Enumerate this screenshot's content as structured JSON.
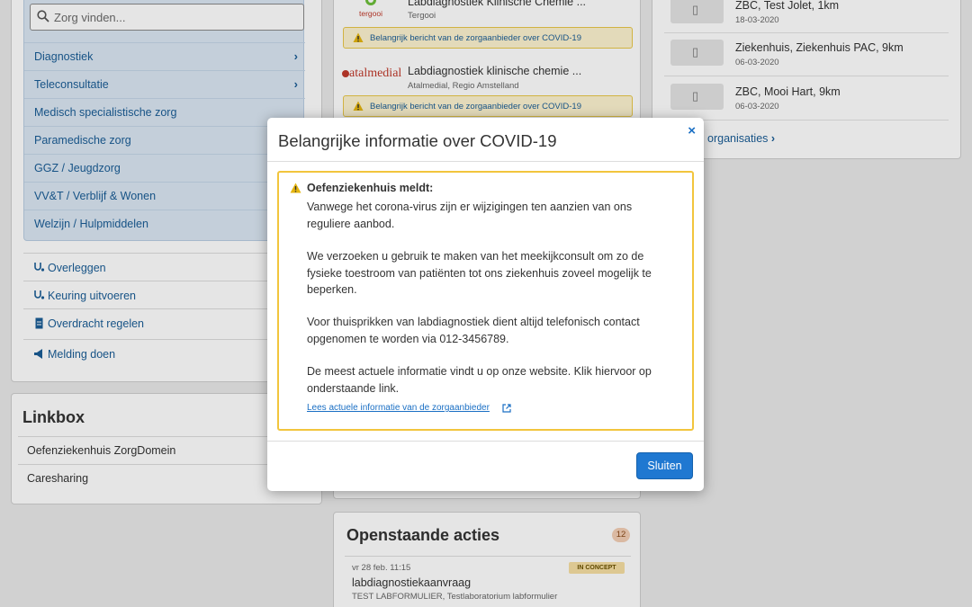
{
  "search": {
    "placeholder": "Zorg vinden..."
  },
  "categories": [
    {
      "label": "Diagnostiek"
    },
    {
      "label": "Teleconsultatie"
    },
    {
      "label": "Medisch specialistische zorg"
    },
    {
      "label": "Paramedische zorg"
    },
    {
      "label": "GGZ / Jeugdzorg"
    },
    {
      "label": "VV&T / Verblijf & Wonen"
    },
    {
      "label": "Welzijn / Hulpmiddelen"
    }
  ],
  "actions": [
    {
      "label": "Overleggen",
      "icon": "stethoscope-icon"
    },
    {
      "label": "Keuring uitvoeren",
      "icon": "stethoscope-icon"
    },
    {
      "label": "Overdracht regelen",
      "icon": "document-icon"
    },
    {
      "label": "Melding doen",
      "icon": "megaphone-icon"
    }
  ],
  "linkbox": {
    "title": "Linkbox",
    "items": [
      {
        "label": "Oefenziekenhuis ZorgDomein"
      },
      {
        "label": "Caresharing"
      }
    ]
  },
  "providers": [
    {
      "name": "Labdiagnostiek Klinische Chemie ...",
      "sub": "Tergooi",
      "logo_text": "tergooi",
      "warning": "Belangrijk bericht van de zorgaanbieder over COVID-19"
    },
    {
      "name": "Labdiagnostiek klinische chemie ...",
      "sub": "Atalmedial, Regio Amstelland",
      "logo_text": "atalmedial",
      "warning": "Belangrijk bericht van de zorgaanbieder over COVID-19"
    }
  ],
  "recent_orgs": [
    {
      "name": "ZBC, Test Jolet, 1km",
      "date": "18-03-2020"
    },
    {
      "name": "Ziekenhuis, Ziekenhuis PAC, 9km",
      "date": "06-03-2020"
    },
    {
      "name": "ZBC, Mooi Hart, 9km",
      "date": "06-03-2020"
    }
  ],
  "all_orgs_link": "organisaties",
  "open_actions": {
    "title": "Openstaande acties",
    "count": "12",
    "item": {
      "date": "vr 28 feb. 11:15",
      "status": "IN CONCEPT",
      "title": "labdiagnostiekaanvraag",
      "sub": "TEST LABFORMULIER, Testlaboratorium labformulier"
    }
  },
  "modal": {
    "title": "Belangrijke informatie over COVID-19",
    "close_symbol": "×",
    "heading": "Oefenziekenhuis meldt:",
    "paragraphs": [
      "Vanwege het corona-virus zijn er wijzigingen ten aanzien van ons reguliere aanbod.",
      "We verzoeken u gebruik te maken van het meekijkconsult om zo de fysieke toestroom van patiënten tot ons ziekenhuis zoveel mogelijk te beperken.",
      "Voor thuisprikken van labdiagnostiek dient altijd telefonisch contact opgenomen te worden via 012-3456789.",
      "De meest actuele informatie vindt u op onze website. Klik hiervoor op onderstaande link."
    ],
    "link_text": "Lees actuele informatie van de zorgaanbieder",
    "button_label": "Sluiten"
  },
  "colors": {
    "accent": "#1f78d1",
    "warning_border": "#f2c53d",
    "warning_bg": "#fdf3d0",
    "category_bg": "#dbe7f3"
  }
}
